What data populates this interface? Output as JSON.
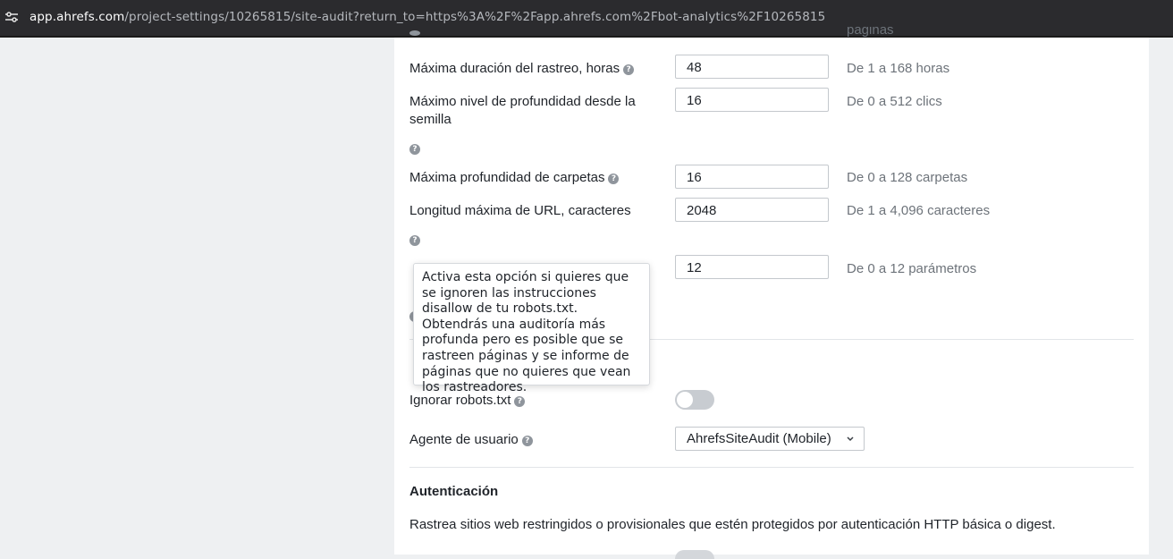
{
  "browser": {
    "url_domain": "app.ahrefs.com",
    "url_path": "/project-settings/10265815/site-audit?return_to=https%3A%2F%2Fapp.ahrefs.com%2Fbot-analytics%2F10265815"
  },
  "settings": {
    "cut_range": "páginas",
    "rows": [
      {
        "label": "Máxima duración del rastreo, horas",
        "value": "48",
        "range": "De 1 a 168 horas"
      },
      {
        "label": "Máximo nivel de profundidad desde la semilla",
        "value": "16",
        "range": "De 0 a 512 clics"
      },
      {
        "label": "Máxima profundidad de carpetas",
        "value": "16",
        "range": "De 0 a 128 carpetas"
      },
      {
        "label": "Longitud máxima de URL, caracteres",
        "value": "2048",
        "range": "De 1 a 4,096 caracteres"
      },
      {
        "label": "",
        "value": "12",
        "range": "De 0 a 12 parámetros"
      }
    ],
    "help_glyph": "?"
  },
  "robots": {
    "label": "Ignorar robots.txt",
    "toggle_on": false,
    "tooltip": "Activa esta opción si quieres que se ignoren las instrucciones disallow de tu robots.txt. Obtendrás una auditoría más profunda pero es posible que se rastreen páginas y se informe de páginas que no quieres que vean los rastreadores."
  },
  "user_agent": {
    "label": "Agente de usuario",
    "selected": "AhrefsSiteAudit (Mobile)"
  },
  "auth": {
    "title": "Autenticación",
    "description": "Rastrea sitios web restringidos o provisionales que estén protegidos por autenticación HTTP básica o digest."
  },
  "icons": {
    "site_info": "tune-icon",
    "help": "question-circle-icon",
    "dropdown": "chevron-down-icon"
  }
}
